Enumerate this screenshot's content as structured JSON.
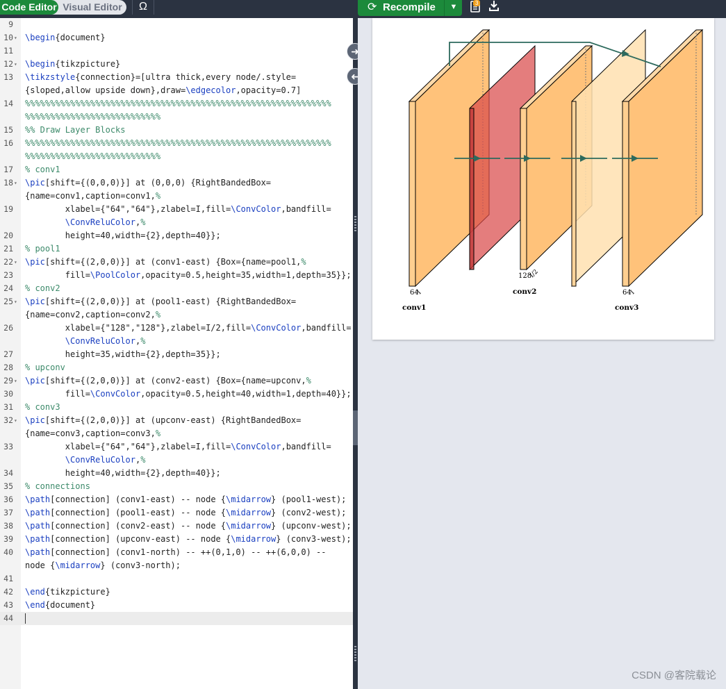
{
  "toolbar": {
    "code_editor_label": "Code Editor",
    "visual_editor_label": "Visual Editor",
    "symbol_label": "Ω",
    "recompile_label": "Recompile",
    "logs_badge": "3"
  },
  "editor": {
    "active_line": "44",
    "lines": [
      {
        "n": "9",
        "fold": "",
        "t": ""
      },
      {
        "n": "10",
        "fold": "▾",
        "t": "\\begin{document}"
      },
      {
        "n": "11",
        "fold": "",
        "t": ""
      },
      {
        "n": "12",
        "fold": "▾",
        "t": "\\begin{tikzpicture}"
      },
      {
        "n": "13",
        "fold": "",
        "t": "\\tikzstyle{connection}=[ultra thick,every node/.style="
      },
      {
        "n": "",
        "fold": "",
        "t": "{sloped,allow upside down},draw=\\edgecolor,opacity=0.7]"
      },
      {
        "n": "14",
        "fold": "",
        "t": "%%%%%%%%%%%%%%%%%%%%%%%%%%%%%%%%%%%%%%%%%%%%%%%%%%%%%%%%%%%%%"
      },
      {
        "n": "",
        "fold": "",
        "t": "%%%%%%%%%%%%%%%%%%%%%%%%%%%"
      },
      {
        "n": "15",
        "fold": "",
        "t": "%% Draw Layer Blocks"
      },
      {
        "n": "16",
        "fold": "",
        "t": "%%%%%%%%%%%%%%%%%%%%%%%%%%%%%%%%%%%%%%%%%%%%%%%%%%%%%%%%%%%%%"
      },
      {
        "n": "",
        "fold": "",
        "t": "%%%%%%%%%%%%%%%%%%%%%%%%%%%"
      },
      {
        "n": "17",
        "fold": "",
        "t": "% conv1"
      },
      {
        "n": "18",
        "fold": "▾",
        "t": "\\pic[shift={(0,0,0)}] at (0,0,0) {RightBandedBox="
      },
      {
        "n": "",
        "fold": "",
        "t": "{name=conv1,caption=conv1,%"
      },
      {
        "n": "19",
        "fold": "",
        "t": "        xlabel={\"64\",\"64\"},zlabel=I,fill=\\ConvColor,bandfill="
      },
      {
        "n": "",
        "fold": "",
        "t": "        \\ConvReluColor,%"
      },
      {
        "n": "20",
        "fold": "",
        "t": "        height=40,width={2},depth=40}};"
      },
      {
        "n": "21",
        "fold": "",
        "t": "% pool1"
      },
      {
        "n": "22",
        "fold": "▾",
        "t": "\\pic[shift={(2,0,0)}] at (conv1-east) {Box={name=pool1,%"
      },
      {
        "n": "23",
        "fold": "",
        "t": "        fill=\\PoolColor,opacity=0.5,height=35,width=1,depth=35}};"
      },
      {
        "n": "24",
        "fold": "",
        "t": "% conv2"
      },
      {
        "n": "25",
        "fold": "▾",
        "t": "\\pic[shift={(2,0,0)}] at (pool1-east) {RightBandedBox="
      },
      {
        "n": "",
        "fold": "",
        "t": "{name=conv2,caption=conv2,%"
      },
      {
        "n": "26",
        "fold": "",
        "t": "        xlabel={\"128\",\"128\"},zlabel=I/2,fill=\\ConvColor,bandfill="
      },
      {
        "n": "",
        "fold": "",
        "t": "        \\ConvReluColor,%"
      },
      {
        "n": "27",
        "fold": "",
        "t": "        height=35,width={2},depth=35}};"
      },
      {
        "n": "28",
        "fold": "",
        "t": "% upconv"
      },
      {
        "n": "29",
        "fold": "▾",
        "t": "\\pic[shift={(2,0,0)}] at (conv2-east) {Box={name=upconv,%"
      },
      {
        "n": "30",
        "fold": "",
        "t": "        fill=\\ConvColor,opacity=0.5,height=40,width=1,depth=40}};"
      },
      {
        "n": "31",
        "fold": "",
        "t": "% conv3"
      },
      {
        "n": "32",
        "fold": "▾",
        "t": "\\pic[shift={(2,0,0)}] at (upconv-east) {RightBandedBox="
      },
      {
        "n": "",
        "fold": "",
        "t": "{name=conv3,caption=conv3,%"
      },
      {
        "n": "33",
        "fold": "",
        "t": "        xlabel={\"64\",\"64\"},zlabel=I,fill=\\ConvColor,bandfill="
      },
      {
        "n": "",
        "fold": "",
        "t": "        \\ConvReluColor,%"
      },
      {
        "n": "34",
        "fold": "",
        "t": "        height=40,width={2},depth=40}};"
      },
      {
        "n": "35",
        "fold": "",
        "t": "% connections"
      },
      {
        "n": "36",
        "fold": "",
        "t": "\\path[connection] (conv1-east) -- node {\\midarrow} (pool1-west);"
      },
      {
        "n": "37",
        "fold": "",
        "t": "\\path[connection] (pool1-east) -- node {\\midarrow} (conv2-west);"
      },
      {
        "n": "38",
        "fold": "",
        "t": "\\path[connection] (conv2-east) -- node {\\midarrow} (upconv-west);"
      },
      {
        "n": "39",
        "fold": "",
        "t": "\\path[connection] (upconv-east) -- node {\\midarrow} (conv3-west);"
      },
      {
        "n": "40",
        "fold": "",
        "t": "\\path[connection] (conv1-north) -- ++(0,1,0) -- ++(6,0,0) --"
      },
      {
        "n": "",
        "fold": "",
        "t": "node {\\midarrow} (conv3-north);"
      },
      {
        "n": "41",
        "fold": "",
        "t": ""
      },
      {
        "n": "42",
        "fold": "",
        "t": "\\end{tikzpicture}"
      },
      {
        "n": "43",
        "fold": "",
        "t": "\\end{document}"
      },
      {
        "n": "44",
        "fold": "",
        "t": ""
      }
    ]
  },
  "preview": {
    "captions": {
      "conv1": "conv1",
      "conv2": "conv2",
      "conv3": "conv3"
    },
    "labels": {
      "conv1_x": "64",
      "conv1_z": "I",
      "conv2_x": "128",
      "conv2_z": "I/2",
      "conv3_x": "64",
      "conv3_z": "I"
    }
  },
  "watermark": "CSDN @客院载论",
  "colors": {
    "accent": "#1c8a3b",
    "toolbar": "#2b3341",
    "conv": "#ffb366",
    "pool": "#d94b4b",
    "upconv": "#ffd9a0",
    "edge": "#2d6a5d"
  }
}
